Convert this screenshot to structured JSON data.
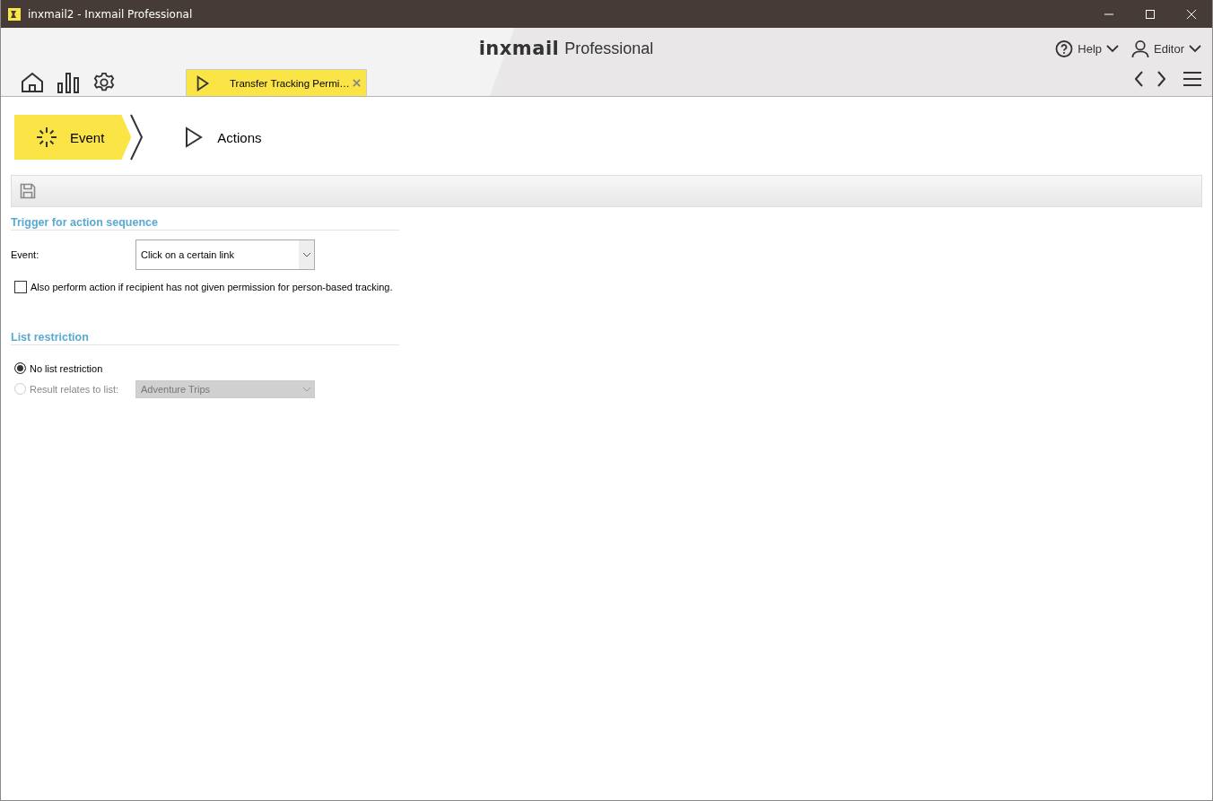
{
  "window": {
    "title": "inxmail2 - Inxmail Professional"
  },
  "header": {
    "logo_word": "inxmail",
    "logo_suffix": "Professional",
    "help": "Help",
    "user": "Editor"
  },
  "tabs": [
    {
      "label": "Transfer Tracking Permi…",
      "selected": true
    }
  ],
  "steps": [
    {
      "kind": "event",
      "label": "Event",
      "selected": true
    },
    {
      "kind": "actions",
      "label": "Actions",
      "selected": false
    }
  ],
  "trigger": {
    "title": "Trigger for action sequence",
    "event_label": "Event:",
    "event_value": "Click on a certain link",
    "checkbox": {
      "label": "Also perform action if recipient has not given permission for person-based tracking.",
      "checked": false
    }
  },
  "list_restriction": {
    "title": "List restriction",
    "options": [
      {
        "label": "No list restriction",
        "selected": true,
        "disabled": false
      },
      {
        "label": "Result relates to list:",
        "selected": false,
        "disabled": true
      }
    ],
    "list_value": "Adventure Trips",
    "list_disabled": true
  }
}
